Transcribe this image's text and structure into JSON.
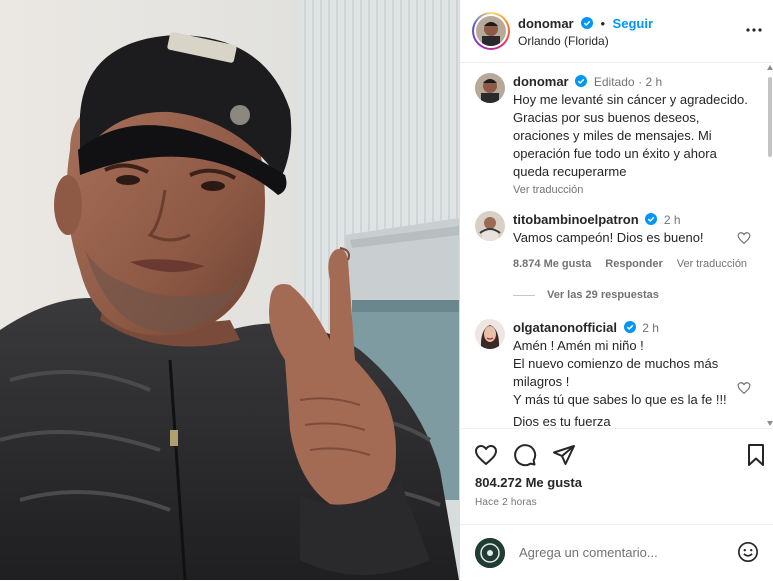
{
  "post": {
    "username": "donomar",
    "follow_label": "Seguir",
    "location": "Orlando (Florida)",
    "verified": true
  },
  "caption": {
    "username": "donomar",
    "edited_label": "Editado",
    "time": "2 h",
    "text": "Hoy me levanté sin cáncer y agradecido. Gracias por sus buenos deseos, oraciones y miles de mensajes. Mi operación fue todo un éxito y ahora queda recuperarme",
    "translate_label": "Ver traducción"
  },
  "comments": [
    {
      "username": "titobambinoelpatron",
      "time": "2 h",
      "text": "Vamos campeón! Dios es bueno!",
      "likes_label": "8.874 Me gusta",
      "reply_label": "Responder",
      "translate_label": "Ver traducción",
      "replies_label": "Ver las 29 respuestas"
    },
    {
      "username": "olgatanonofficial",
      "time": "2 h",
      "text": "Amén ! Amén mi niño !\nEl nuevo comienzo de muchos más milagros !\nY más tú que sabes lo que es la fe !!!",
      "partial_text": "Dios es tu fuerza"
    }
  ],
  "footer": {
    "likes": "804.272 Me gusta",
    "posted": "Hace 2 horas"
  },
  "comment_input": {
    "placeholder": "Agrega un comentario..."
  },
  "icons": {
    "verified": "verified-badge-icon",
    "more": "more-options-icon",
    "like": "heart-icon",
    "comment": "comment-bubble-icon",
    "share": "paper-plane-icon",
    "save": "bookmark-icon",
    "emoji": "emoji-icon"
  },
  "colors": {
    "accent": "#0095f6",
    "text": "#262626",
    "muted": "#737373"
  }
}
